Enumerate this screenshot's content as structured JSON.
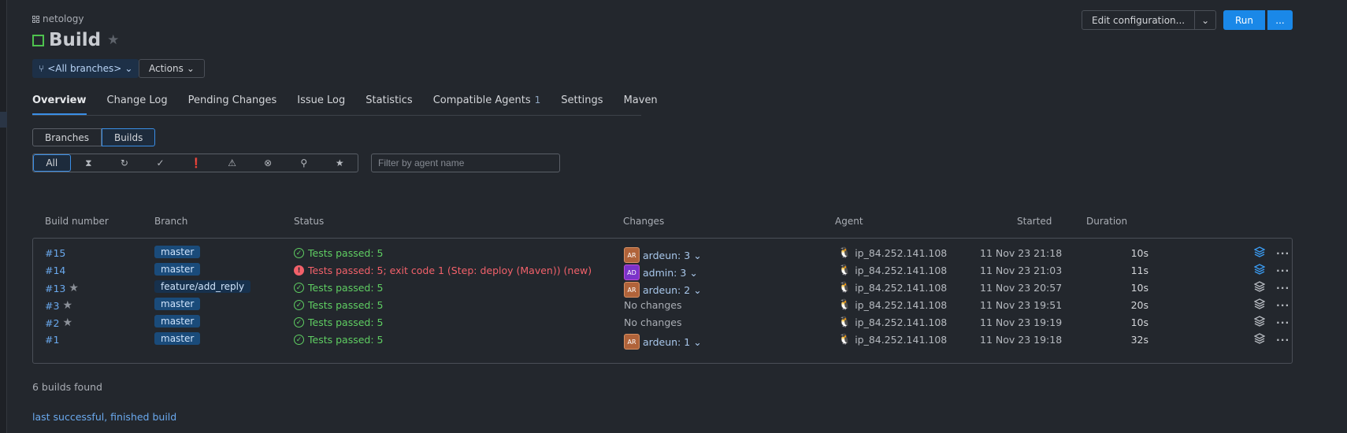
{
  "breadcrumb": {
    "project": "netology"
  },
  "page": {
    "title": "Build"
  },
  "branch_selector": {
    "label": "<All branches>"
  },
  "actions": {
    "label": "Actions"
  },
  "toolbar": {
    "edit_config": "Edit configuration...",
    "run": "Run",
    "run_more": "..."
  },
  "tabs": [
    {
      "label": "Overview",
      "active": true
    },
    {
      "label": "Change Log"
    },
    {
      "label": "Pending Changes"
    },
    {
      "label": "Issue Log"
    },
    {
      "label": "Statistics"
    },
    {
      "label": "Compatible Agents",
      "count": "1"
    },
    {
      "label": "Settings"
    },
    {
      "label": "Maven"
    }
  ],
  "view_toggle": {
    "branches": "Branches",
    "builds": "Builds",
    "selected": "Builds"
  },
  "filters": {
    "all": "All",
    "icons": [
      "hourglass-icon",
      "running-icon",
      "success-icon",
      "error-icon",
      "warning-icon",
      "cancelled-icon",
      "pin-icon",
      "star-icon"
    ]
  },
  "agent_filter": {
    "placeholder": "Filter by agent name",
    "value": ""
  },
  "table": {
    "headers": {
      "build_number": "Build number",
      "branch": "Branch",
      "status": "Status",
      "changes": "Changes",
      "agent": "Agent",
      "started": "Started",
      "duration": "Duration"
    },
    "rows": [
      {
        "number": "#15",
        "starred": false,
        "branch": "master",
        "status": "Tests passed: 5",
        "status_type": "success",
        "changes": "ardeun: 3",
        "avatar": "AR",
        "agent": "ip_84.252.141.108",
        "started": "11 Nov 23 21:18",
        "duration": "10s",
        "layers_active": true
      },
      {
        "number": "#14",
        "starred": false,
        "branch": "master",
        "status": "Tests passed: 5; exit code 1 (Step: deploy (Maven)) (new)",
        "status_type": "error",
        "changes": "admin: 3",
        "avatar": "AD",
        "agent": "ip_84.252.141.108",
        "started": "11 Nov 23 21:03",
        "duration": "11s",
        "layers_active": true
      },
      {
        "number": "#13",
        "starred": true,
        "branch": "feature/add_reply",
        "status": "Tests passed: 5",
        "status_type": "success",
        "changes": "ardeun: 2",
        "avatar": "AR",
        "agent": "ip_84.252.141.108",
        "started": "11 Nov 23 20:57",
        "duration": "10s",
        "layers_active": false
      },
      {
        "number": "#3",
        "starred": true,
        "branch": "master",
        "status": "Tests passed: 5",
        "status_type": "success",
        "changes": "No changes",
        "avatar": "",
        "agent": "ip_84.252.141.108",
        "started": "11 Nov 23 19:51",
        "duration": "20s",
        "layers_active": false
      },
      {
        "number": "#2",
        "starred": true,
        "branch": "master",
        "status": "Tests passed: 5",
        "status_type": "success",
        "changes": "No changes",
        "avatar": "",
        "agent": "ip_84.252.141.108",
        "started": "11 Nov 23 19:19",
        "duration": "10s",
        "layers_active": false
      },
      {
        "number": "#1",
        "starred": false,
        "branch": "master",
        "status": "Tests passed: 5",
        "status_type": "success",
        "changes": "ardeun: 1",
        "avatar": "AR",
        "agent": "ip_84.252.141.108",
        "started": "11 Nov 23 19:18",
        "duration": "32s",
        "layers_active": false
      }
    ]
  },
  "summary": {
    "found": "6 builds found",
    "last_link": "last successful, finished build"
  },
  "colors": {
    "accent": "#1a88e8",
    "success": "#5fce62",
    "error": "#f2616a",
    "link": "#6aa9ee"
  }
}
